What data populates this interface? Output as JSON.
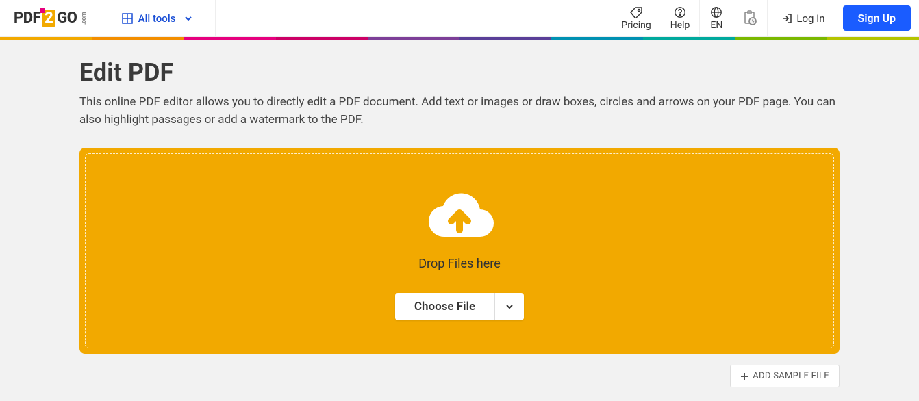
{
  "header": {
    "logo_pdf": "PDF",
    "logo_2": "2",
    "logo_go": "GO",
    "logo_com": ".com",
    "all_tools": "All tools",
    "pricing": "Pricing",
    "help": "Help",
    "language": "EN",
    "login": "Log In",
    "signup": "Sign Up"
  },
  "colorstrip": [
    "#f2a900",
    "#f38e00",
    "#e6007e",
    "#cc0066",
    "#7d3f98",
    "#5a3f98",
    "#0091b2",
    "#00a99d",
    "#7ab800",
    "#b4c400"
  ],
  "main": {
    "title": "Edit PDF",
    "subtitle": "This online PDF editor allows you to directly edit a PDF document. Add text or images or draw boxes, circles and arrows on your PDF page. You can also highlight passages or add a watermark to the PDF.",
    "drop_text": "Drop Files here",
    "choose_file": "Choose File",
    "add_sample": "ADD SAMPLE FILE"
  }
}
